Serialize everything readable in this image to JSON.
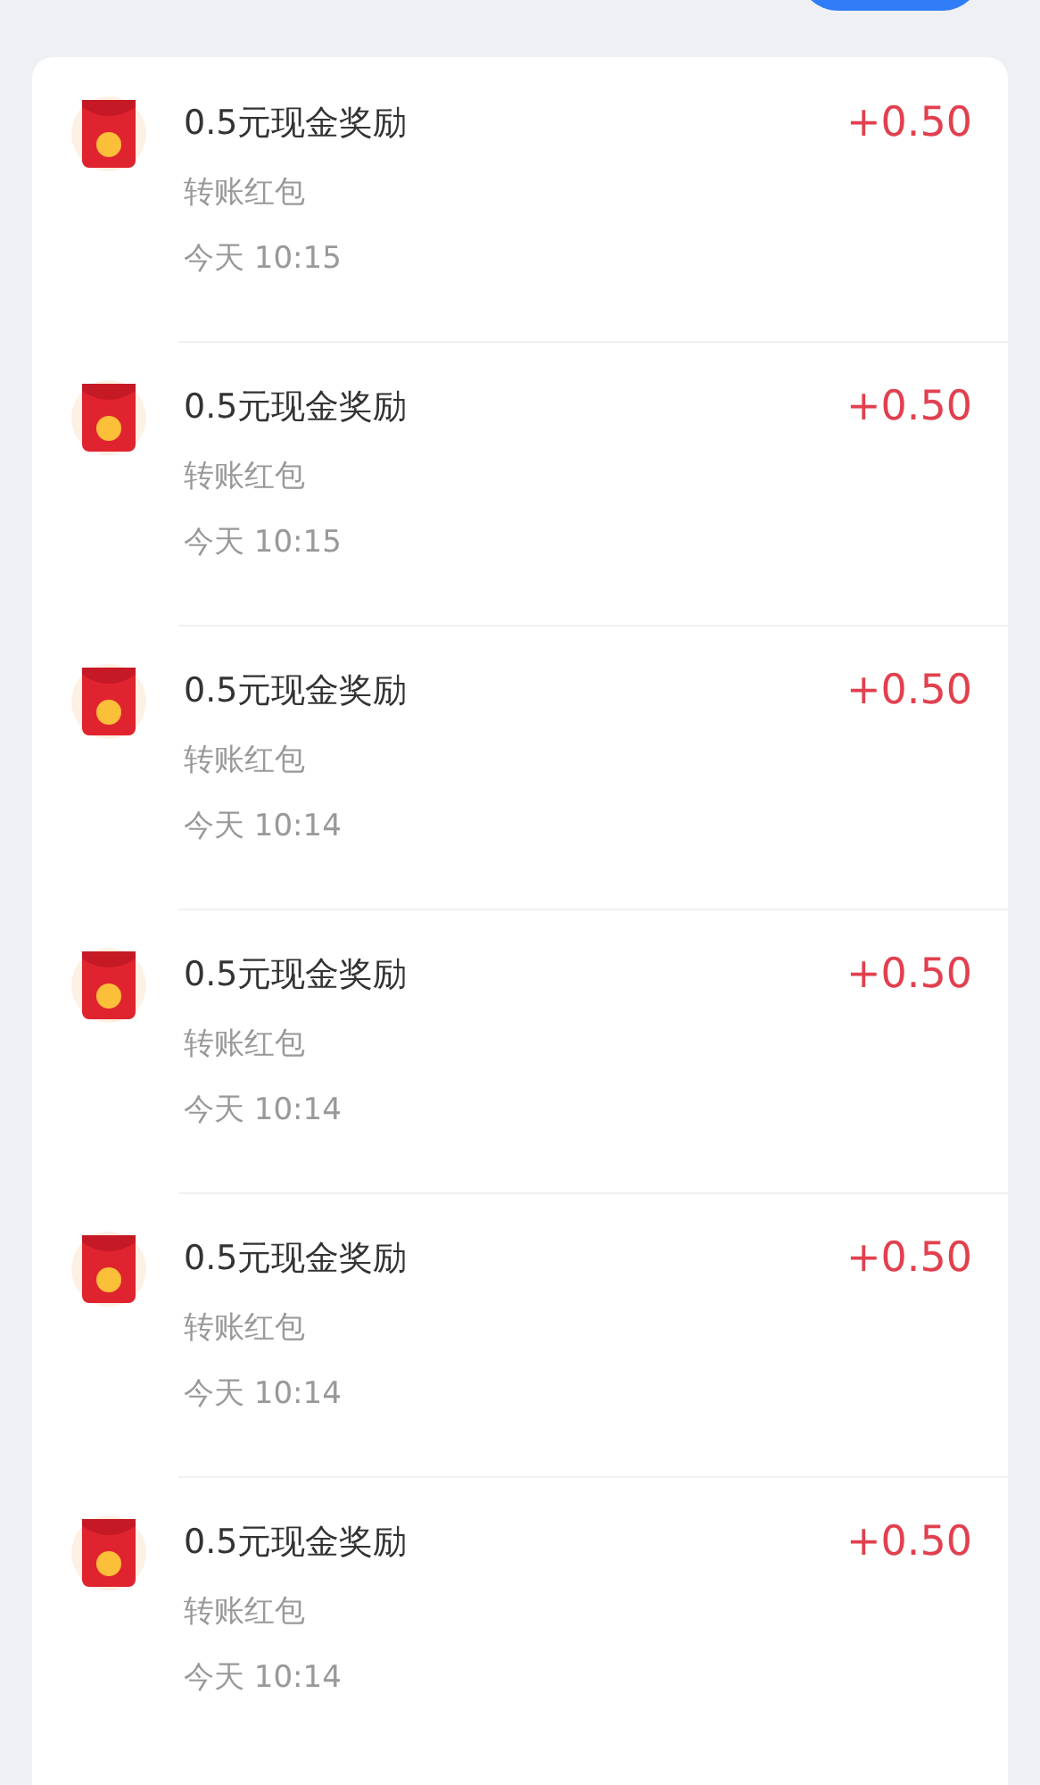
{
  "records": [
    {
      "title": "0.5元现金奖励",
      "subtitle": "转账红包",
      "time": "今天 10:15",
      "amount": "+0.50"
    },
    {
      "title": "0.5元现金奖励",
      "subtitle": "转账红包",
      "time": "今天 10:15",
      "amount": "+0.50"
    },
    {
      "title": "0.5元现金奖励",
      "subtitle": "转账红包",
      "time": "今天 10:14",
      "amount": "+0.50"
    },
    {
      "title": "0.5元现金奖励",
      "subtitle": "转账红包",
      "time": "今天 10:14",
      "amount": "+0.50"
    },
    {
      "title": "0.5元现金奖励",
      "subtitle": "转账红包",
      "time": "今天 10:14",
      "amount": "+0.50"
    },
    {
      "title": "0.5元现金奖励",
      "subtitle": "转账红包",
      "time": "今天 10:14",
      "amount": "+0.50"
    }
  ]
}
